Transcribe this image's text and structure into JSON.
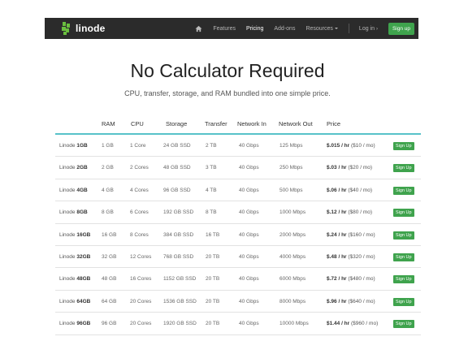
{
  "nav": {
    "logo_text": "linode",
    "home_icon": "home-icon",
    "links": [
      "Features",
      "Pricing",
      "Add-ons",
      "Resources"
    ],
    "login": "Log in",
    "signup": "Sign up",
    "brand_color": "#3fa34d"
  },
  "hero": {
    "title": "No Calculator Required",
    "subtitle": "CPU, transfer, storage, and RAM bundled into one simple price."
  },
  "table": {
    "headers": [
      "RAM",
      "CPU",
      "Storage",
      "Transfer",
      "Network In",
      "Network Out",
      "Price"
    ],
    "accent_color": "#58c2c9",
    "rows": [
      {
        "plan_prefix": "Linode",
        "plan_size": "1GB",
        "ram": "1 GB",
        "cpu": "1 Core",
        "storage": "24 GB SSD",
        "transfer": "2 TB",
        "net_in": "40 Gbps",
        "net_out": "125 Mbps",
        "price_hourly": "$.015 / hr",
        "price_monthly": "($10 / mo)",
        "action": "Sign Up"
      },
      {
        "plan_prefix": "Linode",
        "plan_size": "2GB",
        "ram": "2 GB",
        "cpu": "2 Cores",
        "storage": "48 GB SSD",
        "transfer": "3 TB",
        "net_in": "40 Gbps",
        "net_out": "250 Mbps",
        "price_hourly": "$.03 / hr",
        "price_monthly": "($20 / mo)",
        "action": "Sign Up"
      },
      {
        "plan_prefix": "Linode",
        "plan_size": "4GB",
        "ram": "4 GB",
        "cpu": "4 Cores",
        "storage": "96 GB SSD",
        "transfer": "4 TB",
        "net_in": "40 Gbps",
        "net_out": "500 Mbps",
        "price_hourly": "$.06 / hr",
        "price_monthly": "($40 / mo)",
        "action": "Sign Up"
      },
      {
        "plan_prefix": "Linode",
        "plan_size": "8GB",
        "ram": "8 GB",
        "cpu": "6 Cores",
        "storage": "192 GB SSD",
        "transfer": "8 TB",
        "net_in": "40 Gbps",
        "net_out": "1000 Mbps",
        "price_hourly": "$.12 / hr",
        "price_monthly": "($80 / mo)",
        "action": "Sign Up"
      },
      {
        "plan_prefix": "Linode",
        "plan_size": "16GB",
        "ram": "16 GB",
        "cpu": "8 Cores",
        "storage": "384 GB SSD",
        "transfer": "16 TB",
        "net_in": "40 Gbps",
        "net_out": "2000 Mbps",
        "price_hourly": "$.24 / hr",
        "price_monthly": "($160 / mo)",
        "action": "Sign Up"
      },
      {
        "plan_prefix": "Linode",
        "plan_size": "32GB",
        "ram": "32 GB",
        "cpu": "12 Cores",
        "storage": "768 GB SSD",
        "transfer": "20 TB",
        "net_in": "40 Gbps",
        "net_out": "4000 Mbps",
        "price_hourly": "$.48 / hr",
        "price_monthly": "($320 / mo)",
        "action": "Sign Up"
      },
      {
        "plan_prefix": "Linode",
        "plan_size": "48GB",
        "ram": "48 GB",
        "cpu": "16 Cores",
        "storage": "1152 GB SSD",
        "transfer": "20 TB",
        "net_in": "40 Gbps",
        "net_out": "6000 Mbps",
        "price_hourly": "$.72 / hr",
        "price_monthly": "($480 / mo)",
        "action": "Sign Up"
      },
      {
        "plan_prefix": "Linode",
        "plan_size": "64GB",
        "ram": "64 GB",
        "cpu": "20 Cores",
        "storage": "1536 GB SSD",
        "transfer": "20 TB",
        "net_in": "40 Gbps",
        "net_out": "8000 Mbps",
        "price_hourly": "$.96 / hr",
        "price_monthly": "($640 / mo)",
        "action": "Sign Up"
      },
      {
        "plan_prefix": "Linode",
        "plan_size": "96GB",
        "ram": "96 GB",
        "cpu": "20 Cores",
        "storage": "1920 GB SSD",
        "transfer": "20 TB",
        "net_in": "40 Gbps",
        "net_out": "10000 Mbps",
        "price_hourly": "$1.44 / hr",
        "price_monthly": "($960 / mo)",
        "action": "Sign Up"
      }
    ]
  }
}
